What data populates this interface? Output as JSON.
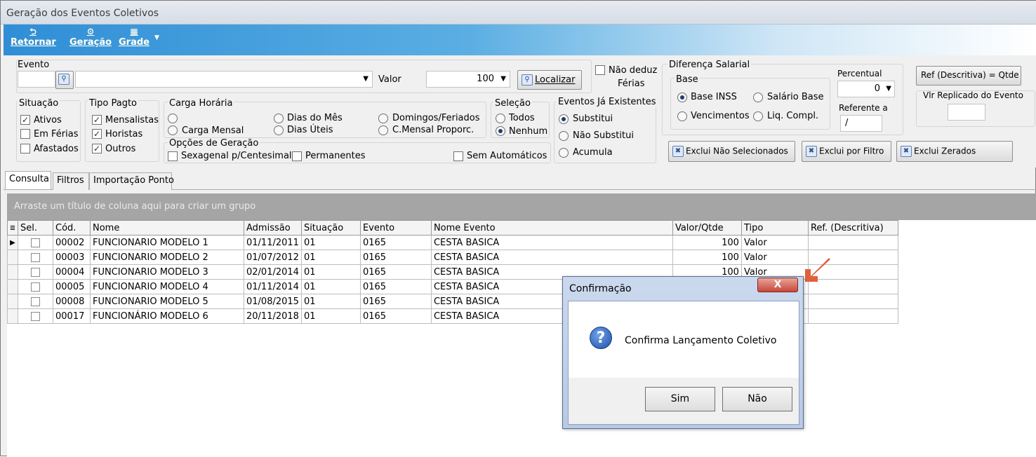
{
  "window": {
    "title": "Geração dos Eventos Coletivos"
  },
  "toolbar": {
    "retornar": "Retornar",
    "geracao": "Geração",
    "grade": "Grade"
  },
  "evento": {
    "label": "Evento",
    "valor_label": "Valor",
    "valor": "100",
    "localizar": "Localizar",
    "nao_deduz_line1": "Não deduz",
    "nao_deduz_line2": "Férias"
  },
  "situacao": {
    "label": "Situação",
    "items": [
      {
        "label": "Ativos",
        "checked": true
      },
      {
        "label": "Em Férias",
        "checked": false
      },
      {
        "label": "Afastados",
        "checked": false
      }
    ]
  },
  "tipo_pagto": {
    "label": "Tipo Pagto",
    "items": [
      {
        "label": "Mensalistas",
        "checked": true
      },
      {
        "label": "Horistas",
        "checked": true
      },
      {
        "label": "Outros",
        "checked": true
      }
    ]
  },
  "carga_horaria": {
    "label": "Carga Horária",
    "carga_mensal": "Carga Mensal",
    "dias_mes": "Dias do Mês",
    "dias_uteis": "Dias Úteis",
    "domingos": "Domingos/Feriados",
    "cmensal": "C.Mensal Proporc."
  },
  "opcoes": {
    "label": "Opções de Geração",
    "sexagenal": "Sexagenal p/Centesimal",
    "permanentes": "Permanentes",
    "sem_automaticos": "Sem Automáticos"
  },
  "selecao": {
    "label": "Seleção",
    "todos": "Todos",
    "nenhum": "Nenhum",
    "selected": "Nenhum"
  },
  "eventos_existentes": {
    "label": "Eventos Já Existentes",
    "substitui": "Substitui",
    "nao_substitui": "Não Substitui",
    "acumula": "Acumula",
    "selected": "Substitui"
  },
  "diferenca": {
    "label": "Diferença Salarial",
    "base_label": "Base",
    "base_inss": "Base INSS",
    "salario_base": "Salário Base",
    "vencimentos": "Vencimentos",
    "liq_compl": "Liq. Compl.",
    "percentual_label": "Percentual",
    "percentual": "0",
    "referente_label": "Referente a",
    "referente": "/"
  },
  "right_panel": {
    "ref_btn": "Ref (Descritiva) = Qtde",
    "vlr_replicado": "Vlr Replicado do  Evento"
  },
  "actions": {
    "exclui_nao_sel": "Exclui Não Selecionados",
    "exclui_filtro": "Exclui por Filtro",
    "exclui_zerados": "Exclui Zerados"
  },
  "tabs": [
    "Consulta",
    "Filtros",
    "Importação Ponto"
  ],
  "grid": {
    "group_hint": "Arraste um título de coluna aqui para criar um grupo",
    "columns": [
      "Sel.",
      "Cód.",
      "Nome",
      "Admissão",
      "Situação",
      "Evento",
      "Nome Evento",
      "Valor/Qtde",
      "Tipo",
      "Ref. (Descritiva)"
    ],
    "rows": [
      [
        "00002",
        "FUNCIONARIO MODELO 1",
        "01/11/2011",
        "01",
        "0165",
        "CESTA BASICA",
        "100",
        "Valor"
      ],
      [
        "00003",
        "FUNCIONARIO MODELO 2",
        "01/07/2012",
        "01",
        "0165",
        "CESTA BASICA",
        "100",
        "Valor"
      ],
      [
        "00004",
        "FUNCIONARIO MODELO 3",
        "02/01/2014",
        "01",
        "0165",
        "CESTA BASICA",
        "100",
        "Valor"
      ],
      [
        "00005",
        "FUNCIONARIO MODELO 4",
        "01/11/2014",
        "01",
        "0165",
        "CESTA BASICA",
        "",
        ""
      ],
      [
        "00008",
        "FUNCIONARIO MODELO 5",
        "01/08/2015",
        "01",
        "0165",
        "CESTA BASICA",
        "",
        ""
      ],
      [
        "00017",
        "FUNCIONÁRIO MODELO 6",
        "20/11/2018",
        "01",
        "0165",
        "CESTA BASICA",
        "",
        ""
      ]
    ]
  },
  "dialog": {
    "title": "Confirmação",
    "close": "X",
    "message": "Confirma Lançamento Coletivo",
    "yes": "Sim",
    "no": "Não"
  },
  "colors": {
    "ribbon": "#2f8ed6",
    "arrow": "#e0603c",
    "group_bar": "#a5a5a5"
  }
}
